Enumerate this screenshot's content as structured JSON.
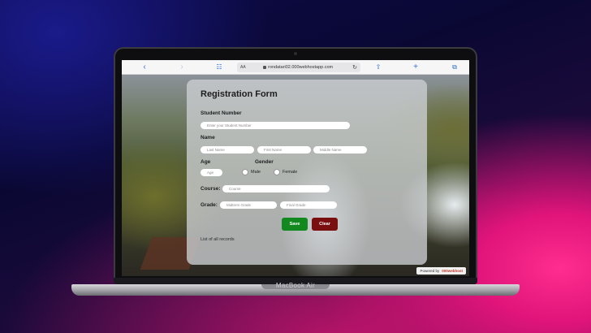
{
  "device": {
    "model": "MacBook Air"
  },
  "browser": {
    "text_size_button": "AA",
    "url": "rondatari02.000webhostapp.com",
    "icons": [
      "back-icon",
      "forward-icon",
      "bookmarks-icon",
      "lock-icon",
      "reload-icon",
      "share-icon",
      "new-tab-icon",
      "tabs-icon"
    ]
  },
  "form": {
    "title": "Registration Form",
    "student_number": {
      "label": "Student Number",
      "placeholder": "Enter your Student Number"
    },
    "name": {
      "label": "Name",
      "last_placeholder": "Last Name",
      "first_placeholder": "First Name",
      "middle_placeholder": "Middle Name"
    },
    "age": {
      "label": "Age",
      "placeholder": "Age"
    },
    "gender": {
      "label": "Gender",
      "options": [
        "Male",
        "Female"
      ]
    },
    "course": {
      "label": "Course:",
      "placeholder": "Course"
    },
    "grade": {
      "label": "Grade:",
      "midterm_placeholder": "Midterm Grade",
      "final_placeholder": "Final Grade"
    },
    "buttons": {
      "save": "Save",
      "clear": "Clear"
    },
    "records_link": "List of all records"
  },
  "footer": {
    "powered_prefix": "Powered by",
    "powered_brand": "000webhost"
  },
  "colors": {
    "save": "#11891e",
    "clear": "#7a0f0f",
    "link": "#2e6fd9",
    "bg_pink": "#ff2d8e",
    "bg_navy": "#0d0b4a"
  }
}
